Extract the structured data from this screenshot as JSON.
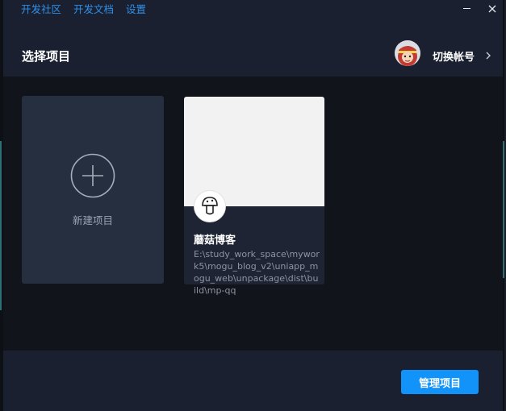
{
  "top_links": [
    "开发社区",
    "开发文档",
    "设置"
  ],
  "header": {
    "title": "选择项目",
    "switch_account": "切换帐号"
  },
  "new_project": {
    "label": "新建项目"
  },
  "project": {
    "name": "蘑菇博客",
    "path": "E:\\study_work_space\\mywork5\\mogu_blog_v2\\uniapp_mogu_web\\unpackage\\dist\\build\\mp-qq"
  },
  "footer": {
    "manage_label": "管理项目"
  },
  "icons": {
    "minimize": "minimize-icon",
    "close": "close-icon",
    "avatar": "avatar",
    "chevron": "chevron-right-icon",
    "plus": "plus-circle-icon",
    "project_logo": "mushroom-logo-icon"
  },
  "colors": {
    "link": "#2f8fe8",
    "accent_button": "#1193fa",
    "panel": "#1b2030",
    "background": "#11141b",
    "card": "#252f40"
  }
}
